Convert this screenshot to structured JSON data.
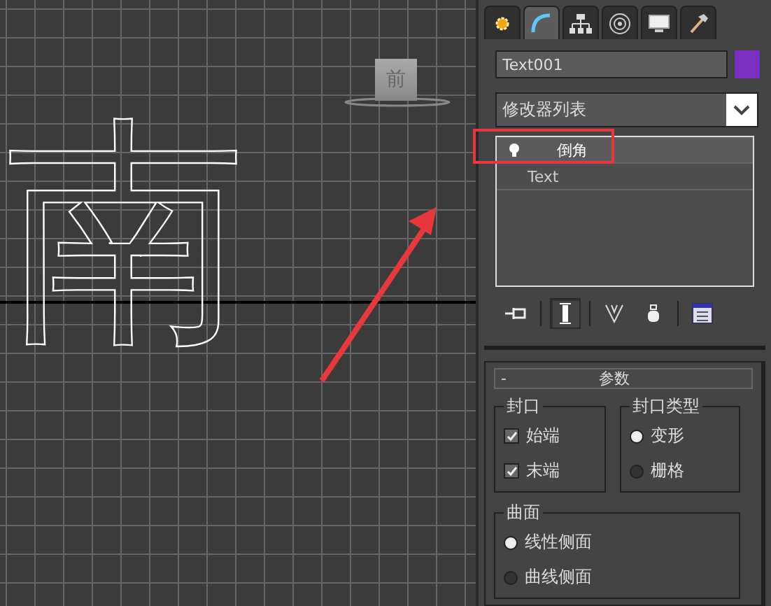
{
  "viewport": {
    "viewcube_label": "前",
    "shape_text": "南"
  },
  "command_panel": {
    "tabs": [
      {
        "kind": "create",
        "selected": false
      },
      {
        "kind": "modify",
        "selected": true
      },
      {
        "kind": "hierarchy",
        "selected": false
      },
      {
        "kind": "motion",
        "selected": false
      },
      {
        "kind": "display",
        "selected": false
      },
      {
        "kind": "utilities",
        "selected": false
      }
    ],
    "object": {
      "name": "Text001",
      "color": "#7b2fbf"
    },
    "modifier_list": "修改器列表",
    "modifier_stack": [
      {
        "kind": "modifier",
        "label": "倒角",
        "selected": true
      },
      {
        "kind": "base",
        "label": "Text",
        "selected": false
      }
    ],
    "stack_toolbar": [
      {
        "kind": "pin",
        "selected": false
      },
      {
        "kind": "show-end",
        "selected": true
      },
      {
        "kind": "unique",
        "selected": false
      },
      {
        "kind": "remove",
        "selected": false
      },
      {
        "kind": "configure",
        "selected": false
      }
    ],
    "rollout": {
      "collapse": "-",
      "title": "参数",
      "groups": [
        {
          "title": "封口",
          "items": [
            {
              "kind": "checkbox",
              "label": "始端",
              "checked": true
            },
            {
              "kind": "checkbox",
              "label": "末端",
              "checked": true
            }
          ]
        },
        {
          "title": "封口类型",
          "items": [
            {
              "kind": "radio",
              "label": "变形",
              "selected": true
            },
            {
              "kind": "radio",
              "label": "栅格",
              "selected": false
            }
          ]
        },
        {
          "title": "曲面",
          "items": [
            {
              "kind": "radio",
              "label": "线性侧面",
              "selected": true
            },
            {
              "kind": "radio",
              "label": "曲线侧面",
              "selected": false
            }
          ]
        }
      ]
    }
  }
}
